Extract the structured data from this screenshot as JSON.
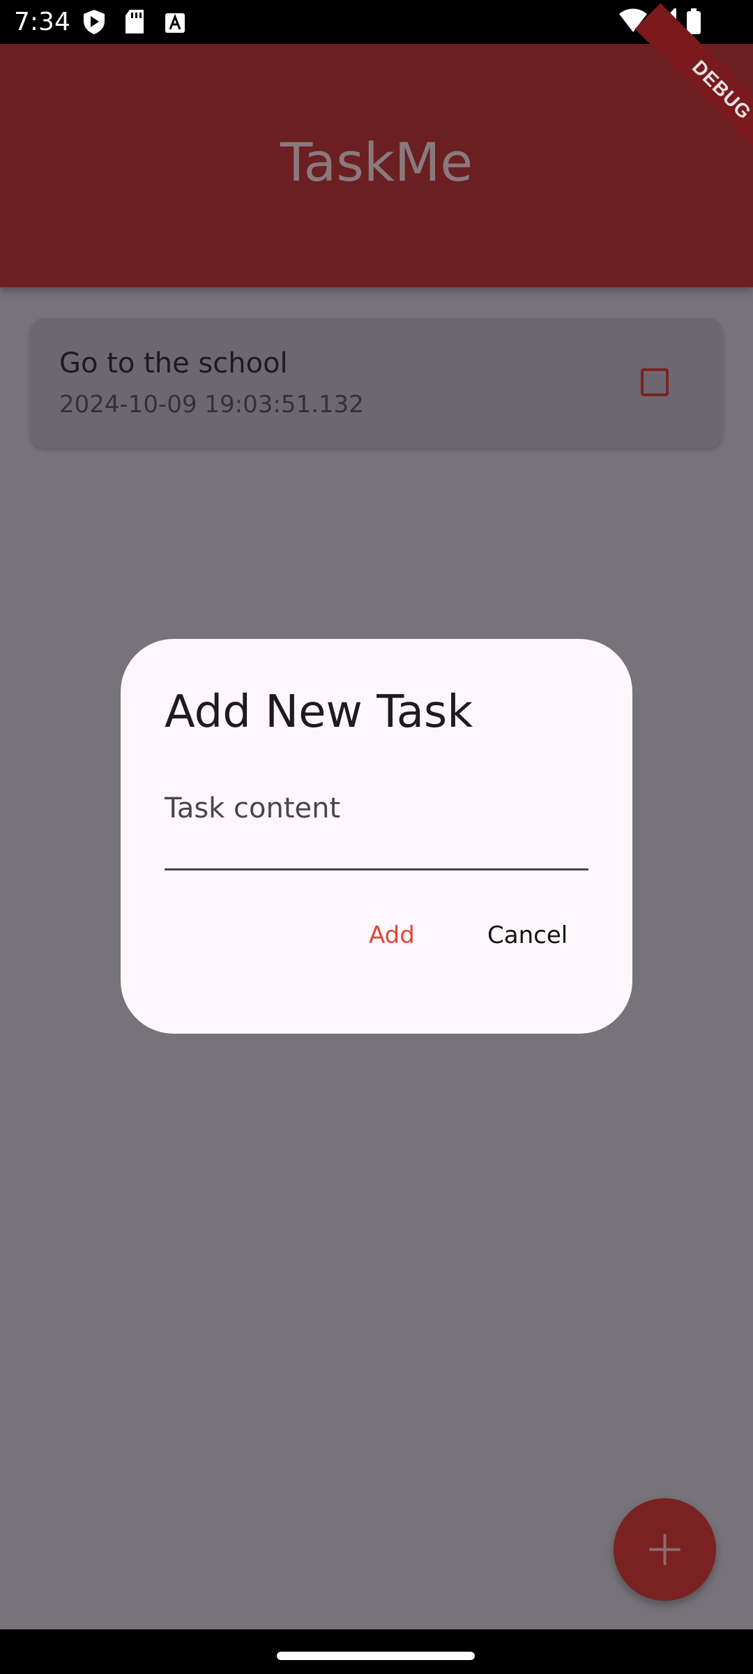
{
  "status_bar": {
    "time": "7:34",
    "icons": [
      "play-protect-icon",
      "sd-card-icon",
      "a-icon",
      "wifi-icon",
      "cell-signal-icon",
      "battery-icon"
    ]
  },
  "app_bar": {
    "title": "TaskMe",
    "debug_label": "DEBUG",
    "color": "#6b1f21"
  },
  "tasks": [
    {
      "title": "Go to the school",
      "timestamp": "2024-10-09 19:03:51.132",
      "checked": false
    }
  ],
  "dialog": {
    "title": "Add New Task",
    "field_label": "Task content",
    "add_label": "Add",
    "cancel_label": "Cancel",
    "accent": "#e0443a"
  },
  "fab": {
    "icon": "plus-icon"
  }
}
